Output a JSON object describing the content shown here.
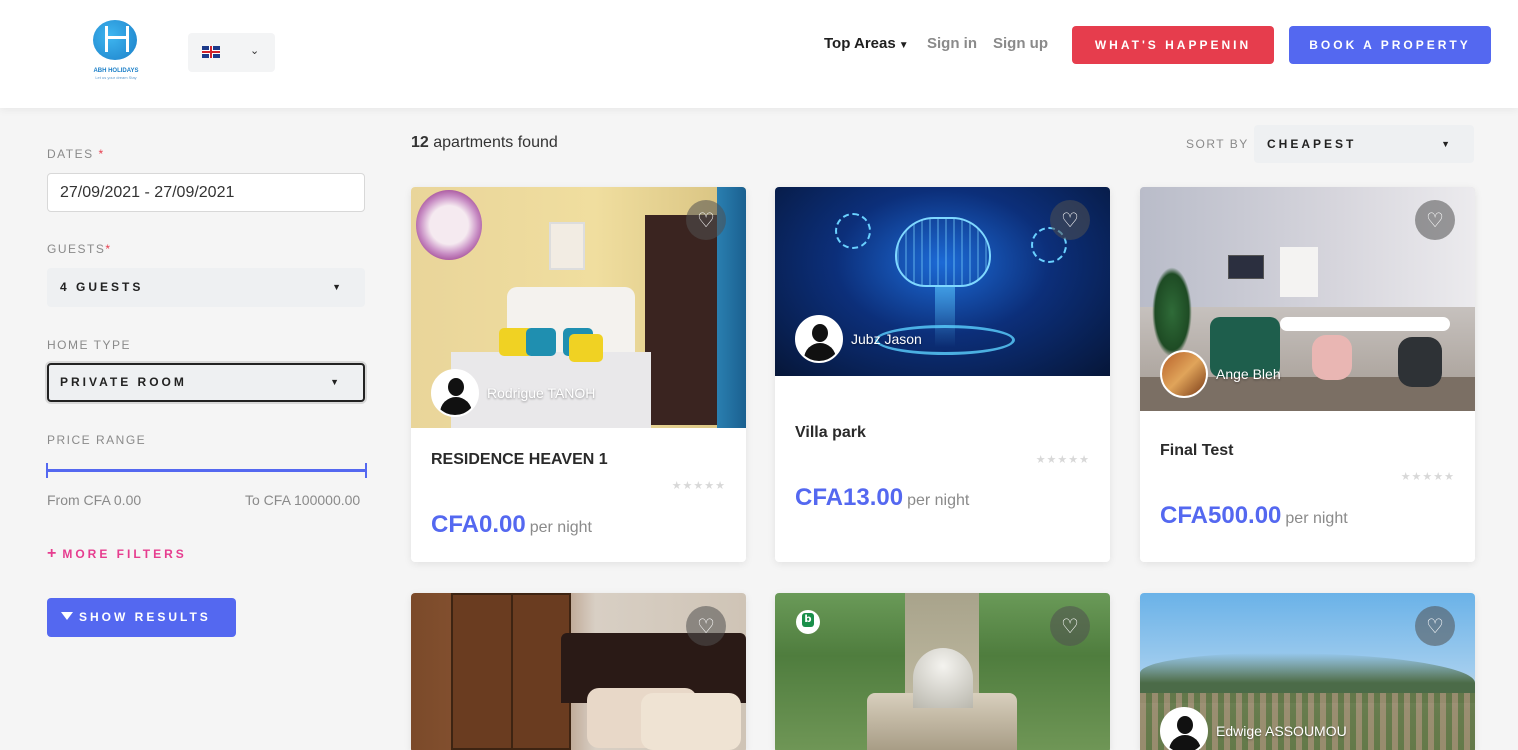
{
  "brand": {
    "name": "ABH HOLIDAYS",
    "tagline": "Let us your dream Stay"
  },
  "language": {
    "selected_icon": "uk-flag-icon"
  },
  "nav": {
    "top_areas": "Top Areas",
    "sign_in": "Sign in",
    "sign_up": "Sign up",
    "whats_happening": "WHAT'S HAPPENIN",
    "book_property": "BOOK A PROPERTY"
  },
  "filters": {
    "dates_label": "DATES",
    "dates_value": "27/09/2021 - 27/09/2021",
    "guests_label": "GUESTS",
    "guests_value": "4 GUESTS",
    "home_type_label": "HOME TYPE",
    "home_type_value": "PRIVATE ROOM",
    "price_label": "PRICE RANGE",
    "price_from": "From CFA 0.00",
    "price_to": "To CFA 100000.00",
    "price_range_fraction": [
      0,
      1
    ],
    "more_filters": "MORE FILTERS",
    "show_results": "SHOW RESULTS",
    "required_mark": "*"
  },
  "results": {
    "count": "12",
    "found_text": "apartments found",
    "sort_label": "SORT BY",
    "sort_value": "CHEAPEST"
  },
  "listings": [
    {
      "title": "RESIDENCE HEAVEN 1",
      "host": "Rodrigue TANOH",
      "price": "CFA0.00",
      "per": "per night",
      "rating": 0
    },
    {
      "title": "Villa park",
      "host": "Jubz Jason",
      "price": "CFA13.00",
      "per": "per night",
      "rating": 0
    },
    {
      "title": "Final Test",
      "host": "Ange Bleh",
      "price": "CFA500.00",
      "per": "per night",
      "rating": 0
    },
    {
      "title": "",
      "host": "",
      "price": "",
      "per": "",
      "rating": 0
    },
    {
      "title": "",
      "host": "",
      "price": "",
      "per": "",
      "rating": 0
    },
    {
      "title": "",
      "host": "Edwige ASSOUMOU",
      "price": "",
      "per": "",
      "rating": 0
    }
  ],
  "colors": {
    "primary": "#5468f0",
    "danger": "#e63d4d",
    "accent": "#e63d8f"
  }
}
